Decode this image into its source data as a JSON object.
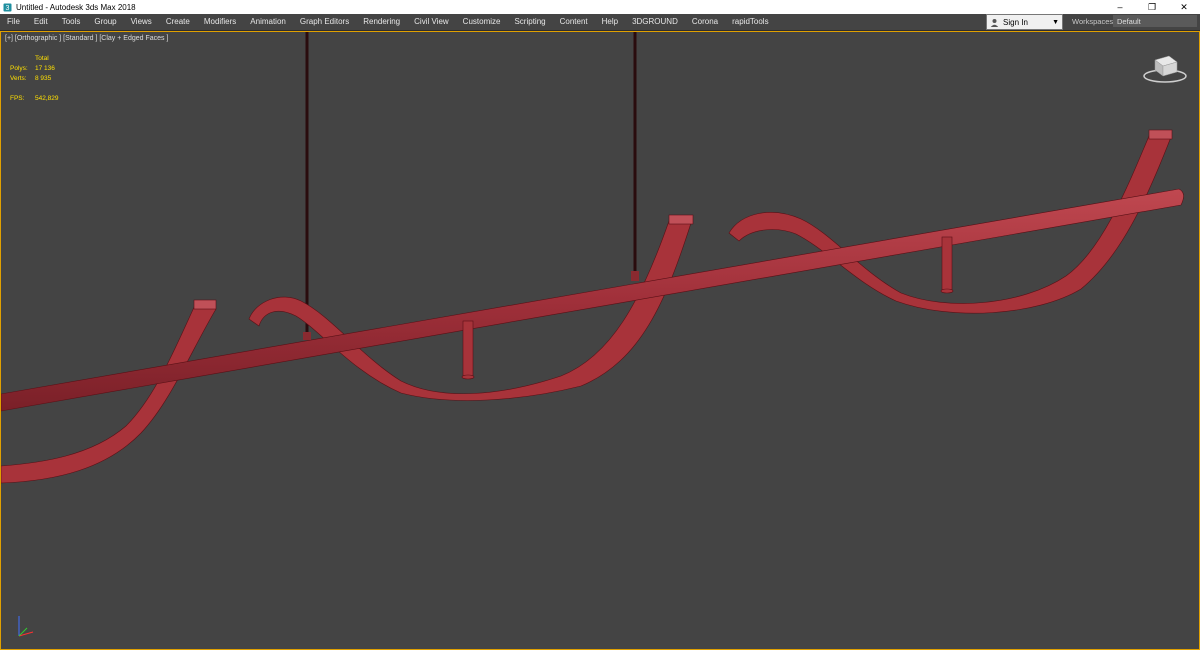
{
  "window": {
    "title": "Untitled - Autodesk 3ds Max 2018",
    "minimize_glyph": "–",
    "restore_glyph": "❐",
    "close_glyph": "✕"
  },
  "menu": [
    "File",
    "Edit",
    "Tools",
    "Group",
    "Views",
    "Create",
    "Modifiers",
    "Animation",
    "Graph Editors",
    "Rendering",
    "Civil View",
    "Customize",
    "Scripting",
    "Content",
    "Help",
    "3DGROUND",
    "Corona",
    "rapidTools"
  ],
  "account": {
    "signin_label": "Sign In",
    "workspaces_label": "Workspaces:",
    "workspace_value": "Default"
  },
  "viewport": {
    "label": "[+] [Orthographic ] [Standard ] [Clay + Edged Faces ]",
    "stats": {
      "header": "Total",
      "polys_label": "Polys:",
      "polys_value": "17 136",
      "verts_label": "Verts:",
      "verts_value": "8 935",
      "fps_label": "FPS:",
      "fps_value": "542,829"
    }
  },
  "colors": {
    "model": "#a8333a",
    "model_edge": "#5a1016",
    "accent": "#e0a000",
    "yellow_text": "#ffe000"
  },
  "icons": [
    "app-icon",
    "user-icon",
    "viewcube-icon",
    "axis-tripod-icon"
  ]
}
